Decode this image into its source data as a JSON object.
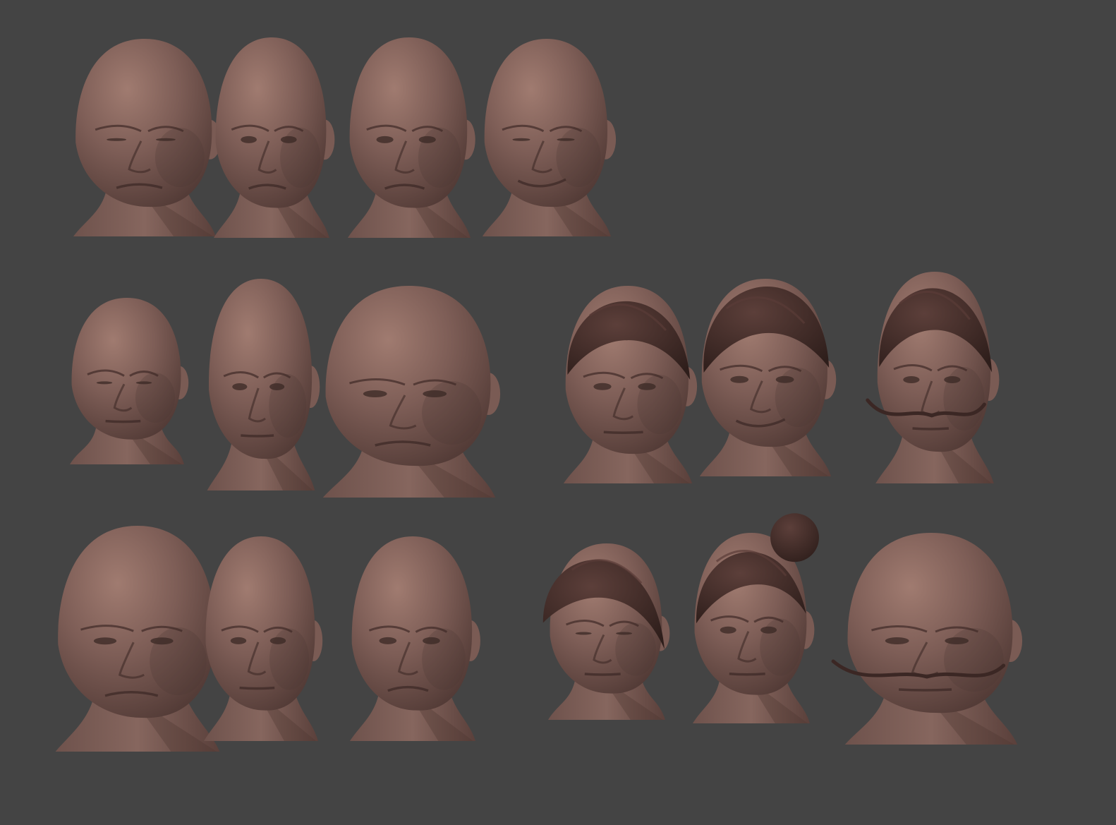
{
  "colors": {
    "background": "#444444",
    "skin": "#7a5b54",
    "skin_light": "#977369",
    "skin_shadow": "#4d3632",
    "hair": "#3b2724",
    "hair_highlight": "#5a3c37",
    "feature_line": "#3e2a27"
  },
  "heads": [
    {
      "id": "r1-1",
      "hair": "none",
      "build": "heavy",
      "expression": "scowl"
    },
    {
      "id": "r1-2",
      "hair": "none",
      "build": "thin",
      "expression": "frown"
    },
    {
      "id": "r1-3",
      "hair": "none",
      "build": "medium",
      "expression": "pout"
    },
    {
      "id": "r1-4",
      "hair": "none",
      "build": "medium",
      "expression": "grin"
    },
    {
      "id": "r2-1",
      "hair": "none",
      "build": "young",
      "expression": "squint"
    },
    {
      "id": "r2-2",
      "hair": "none",
      "build": "thin",
      "expression": "neutral"
    },
    {
      "id": "r2-3",
      "hair": "none",
      "build": "obese",
      "expression": "pout"
    },
    {
      "id": "r2-4",
      "hair": "short",
      "build": "medium",
      "expression": "neutral"
    },
    {
      "id": "r2-5",
      "hair": "pompadour",
      "build": "medium",
      "expression": "smirk"
    },
    {
      "id": "r2-6",
      "hair": "slick",
      "build": "thin",
      "expression": "neutral",
      "accessory": "mustache"
    },
    {
      "id": "r3-1",
      "hair": "none",
      "build": "obese",
      "expression": "frown"
    },
    {
      "id": "r3-2",
      "hair": "none",
      "build": "young",
      "expression": "neutral"
    },
    {
      "id": "r3-3",
      "hair": "none",
      "build": "medium",
      "expression": "frown"
    },
    {
      "id": "r3-4",
      "hair": "swept",
      "build": "young",
      "expression": "squint"
    },
    {
      "id": "r3-5",
      "hair": "bun",
      "build": "young",
      "expression": "neutral"
    },
    {
      "id": "r3-6",
      "hair": "none",
      "build": "obese",
      "expression": "neutral",
      "accessory": "mustache"
    }
  ]
}
